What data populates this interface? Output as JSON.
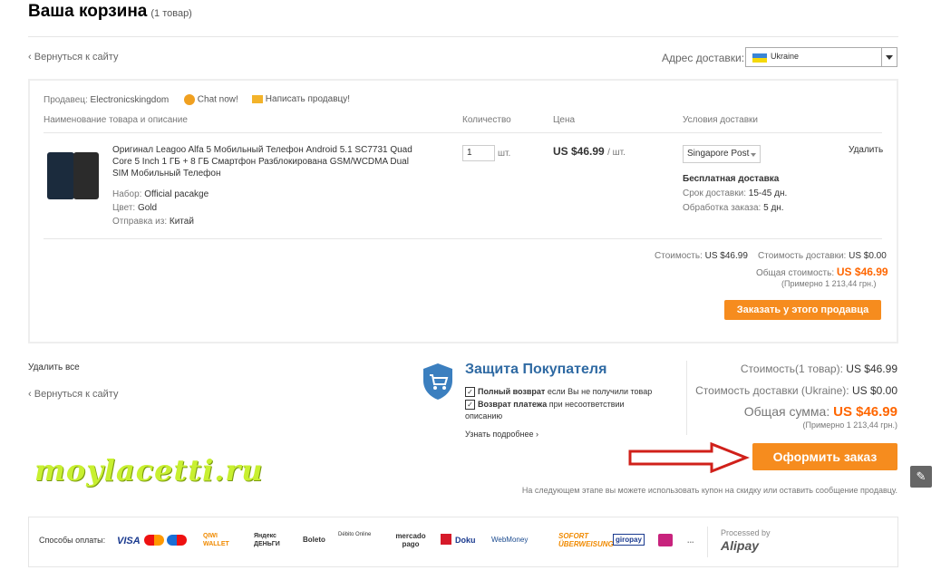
{
  "header": {
    "title": "Ваша корзина",
    "count": "(1 товар)"
  },
  "back_link": "Вернуться к сайту",
  "address": {
    "label": "Адрес доставки:",
    "value": "Ukraine"
  },
  "seller": {
    "label": "Продавец:",
    "name": "Electronicskingdom",
    "chat": "Chat now!",
    "write": "Написать продавцу!"
  },
  "columns": {
    "product": "Наименование товара и описание",
    "qty": "Количество",
    "price": "Цена",
    "shipping": "Условия доставки"
  },
  "item": {
    "title": "Оригинал Leagoo Alfa 5 Мобильный Телефон Android 5.1 SC7731 Quad Core 5 Inch 1 ГБ + 8 ГБ Смартфон Разблокирована GSM/WCDMA Dual SIM Мобильный Телефон",
    "set_label": "Набор:",
    "set_value": "Official pacakge",
    "color_label": "Цвет:",
    "color_value": "Gold",
    "ship_from_label": "Отправка из:",
    "ship_from_value": "Китай",
    "qty": "1",
    "qty_unit": "шт.",
    "price": "US $46.99",
    "price_unit": "/ шт.",
    "ship_method": "Singapore Post",
    "free_shipping": "Бесплатная доставка",
    "delivery_label": "Срок доставки:",
    "delivery_value": "15-45 дн.",
    "processing_label": "Обработка заказа:",
    "processing_value": "5 дн.",
    "delete": "Удалить"
  },
  "seller_summary": {
    "cost_label": "Стоимость:",
    "cost": "US $46.99",
    "ship_label": "Стоимость доставки:",
    "ship": "US $0.00",
    "total_label": "Общая стоимость:",
    "total": "US $46.99",
    "approx": "(Примерно 1 213,44 грн.)",
    "button": "Заказать у этого продавца"
  },
  "delete_all": "Удалить все",
  "protection": {
    "title": "Защита Покупателя",
    "line1_bold": "Полный возврат",
    "line1_rest": "если Вы не получили товар",
    "line2_bold": "Возврат платежа",
    "line2_rest": "при несоответствии описанию",
    "more": "Узнать подробнее"
  },
  "summary": {
    "cost_label": "Стоимость(1 товар):",
    "cost": "US $46.99",
    "ship_label": "Стоимость доставки (Ukraine):",
    "ship": "US $0.00",
    "total_label": "Общая сумма:",
    "total": "US $46.99",
    "approx": "(Примерно 1 213,44 грн.)",
    "button": "Оформить заказ"
  },
  "next_step_note": "На следующем этапе вы можете использовать купон на скидку или оставить сообщение продавцу.",
  "watermark": "moylacetti.ru",
  "payment": {
    "label": "Способы оплаты:",
    "logos": [
      "VISA",
      "QIWI WALLET",
      "Яндекс ДЕНЬГИ",
      "Boleto",
      "Débito Online",
      "mercado pago",
      "Doku",
      "WebMoney",
      "SOFORT ÜBERWEISUNG",
      "giropay",
      "iDeal",
      "...",
      "Processed by",
      "Alipay"
    ]
  },
  "colors": {
    "accent": "#f68c1e",
    "price_orange": "#ff6600",
    "shield_blue": "#3b7fbf"
  }
}
